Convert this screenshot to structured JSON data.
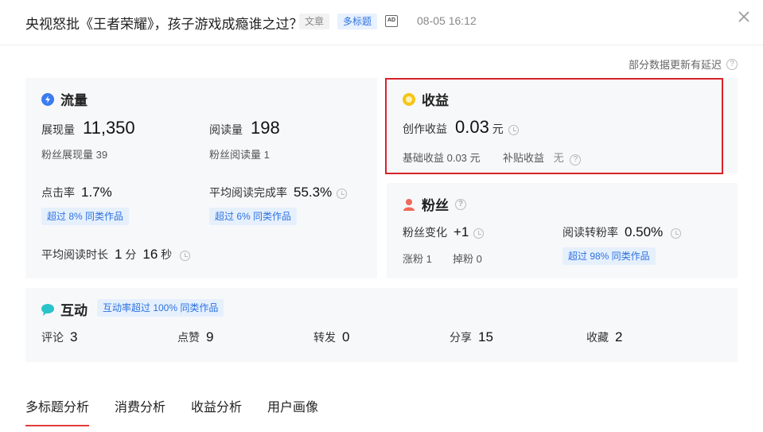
{
  "header": {
    "title": "央视怒批《王者荣耀》，孩子游戏成瘾谁之过？",
    "tag_article": "文章",
    "tag_multi_title": "多标题",
    "ad_icon": "AD",
    "time": "08-05 16:12"
  },
  "notice": "部分数据更新有延迟",
  "traffic": {
    "title": "流量",
    "impressions_label": "展现量",
    "impressions_value": "11,350",
    "reads_label": "阅读量",
    "reads_value": "198",
    "fan_impressions": "粉丝展现量 39",
    "fan_reads": "粉丝阅读量 1",
    "ctr_label": "点击率",
    "ctr_value": "1.7%",
    "ctr_pill": "超过 8% 同类作品",
    "completion_label": "平均阅读完成率",
    "completion_value": "55.3%",
    "completion_pill": "超过 6% 同类作品",
    "duration_label": "平均阅读时长",
    "duration_min": "1",
    "duration_min_unit": "分",
    "duration_sec": "16",
    "duration_sec_unit": "秒"
  },
  "revenue": {
    "title": "收益",
    "creation_label": "创作收益",
    "creation_value": "0.03",
    "creation_unit": "元",
    "base_label": "基础收益 0.03 元",
    "subsidy_label": "补贴收益",
    "subsidy_value": "无"
  },
  "fans": {
    "title": "粉丝",
    "change_label": "粉丝变化",
    "change_value": "+1",
    "conversion_label": "阅读转粉率",
    "conversion_value": "0.50%",
    "gained": "涨粉 1",
    "lost": "掉粉 0",
    "conversion_pill": "超过 98% 同类作品"
  },
  "interaction": {
    "title": "互动",
    "pill": "互动率超过 100% 同类作品",
    "items": [
      {
        "label": "评论",
        "value": "3"
      },
      {
        "label": "点赞",
        "value": "9"
      },
      {
        "label": "转发",
        "value": "0"
      },
      {
        "label": "分享",
        "value": "15"
      },
      {
        "label": "收藏",
        "value": "2"
      }
    ]
  },
  "tabs": [
    "多标题分析",
    "消费分析",
    "收益分析",
    "用户画像"
  ],
  "colors": {
    "accent_blue": "#2d72e0",
    "highlight_red": "#d8232a",
    "tab_underline": "#e33a3a",
    "card_bg": "#f7f8fa"
  }
}
